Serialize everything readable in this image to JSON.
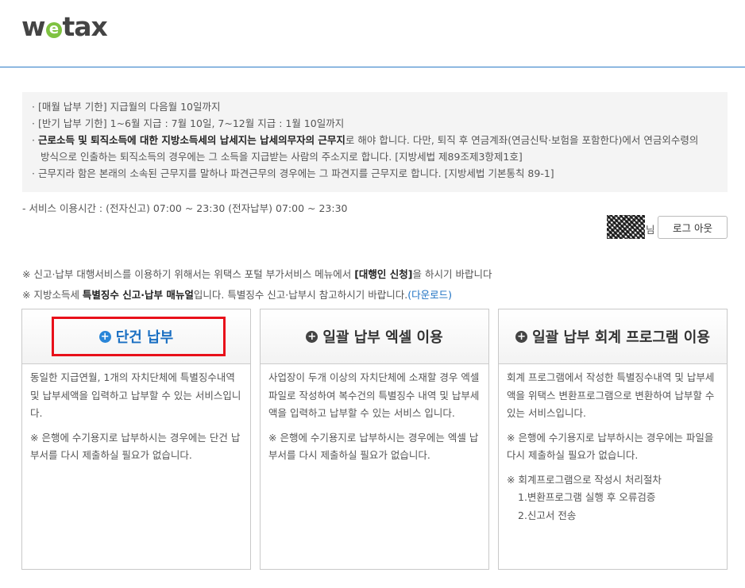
{
  "logo": {
    "before": "w",
    "e": "e",
    "after": "tax"
  },
  "notice": {
    "line1": "· [매월 납부 기한] 지급월의 다음월 10일까지",
    "line2": "· [반기 납부 기한] 1~6월 지급 : 7월 10일, 7~12월 지급 : 1월 10일까지",
    "line3_bold": "근로소득 및 퇴직소득에 대한 지방소득세의 납세지는 납세의무자의 근무지",
    "line3_prefix": "· ",
    "line3_rest": "로 해야 합니다. 다만, 퇴직 후 연금계좌(연금신탁·보험을 포함한다)에서 연금외수령의",
    "line4": "방식으로 인출하는 퇴직소득의 경우에는 그 소득을 지급받는 사람의 주소지로 합니다. [지방세법 제89조제3항제1호]",
    "line5": "· 근무지라 함은 본래의 소속된 근무지를 말하나 파견근무의 경우에는 그 파견지를 근무지로 합니다. [지방세법 기본통칙 89-1]"
  },
  "service_hours": "- 서비스 이용시간 : (전자신고) 07:00 ~ 23:30 (전자납부) 07:00 ~ 23:30",
  "user_suffix": "님",
  "logout_label": "로그 아웃",
  "note1": {
    "prefix": "※ 신고·납부 대행서비스를 이용하기 위해서는 위택스 포털 부가서비스 메뉴에서 ",
    "bold": "[대행인 신청]",
    "suffix": "을 하시기 바랍니다"
  },
  "note2": {
    "prefix": "※ 지방소득세 ",
    "bold": "특별징수 신고·납부 매뉴얼",
    "suffix": "입니다. 특별징수 신고·납부시 참고하시기 바랍니다.",
    "link": "(다운로드)"
  },
  "cards": [
    {
      "title": "단건 납부",
      "desc": "동일한 지급연월, 1개의 자치단체에 특별징수내역 및 납부세액을 입력하고 납부할 수 있는 서비스입니다.",
      "note": "※ 은행에 수기용지로 납부하시는 경우에는 단건 납부서를 다시 제출하실 필요가 없습니다."
    },
    {
      "title": "일괄 납부 엑셀 이용",
      "desc": "사업장이 두개 이상의 자치단체에 소재할 경우 엑셀파일로 작성하여 복수건의 특별징수 내역 및 납부세액을 입력하고 납부할 수 있는 서비스 입니다.",
      "note": "※ 은행에 수기용지로 납부하시는 경우에는 엑셀 납부서를 다시 제출하실 필요가 없습니다."
    },
    {
      "title": "일괄 납부 회계 프로그램 이용",
      "desc": "회계 프로그램에서 작성한 특별징수내역 및 납부세액을 위택스 변환프로그램으로 변환하여 납부할 수 있는 서비스입니다.",
      "note": "※ 은행에 수기용지로 납부하시는 경우에는 파일을 다시 제출하실 필요가 없습니다.",
      "note2_title": "※ 회계프로그램으로 작성시 처리절차",
      "step1": "1.변환프로그램 실행 후 오류검증",
      "step2": "2.신고서 전송"
    }
  ],
  "colors": {
    "accent": "#1a6fc2",
    "highlight": "#e8101a",
    "logo_e": "#7fc241"
  }
}
